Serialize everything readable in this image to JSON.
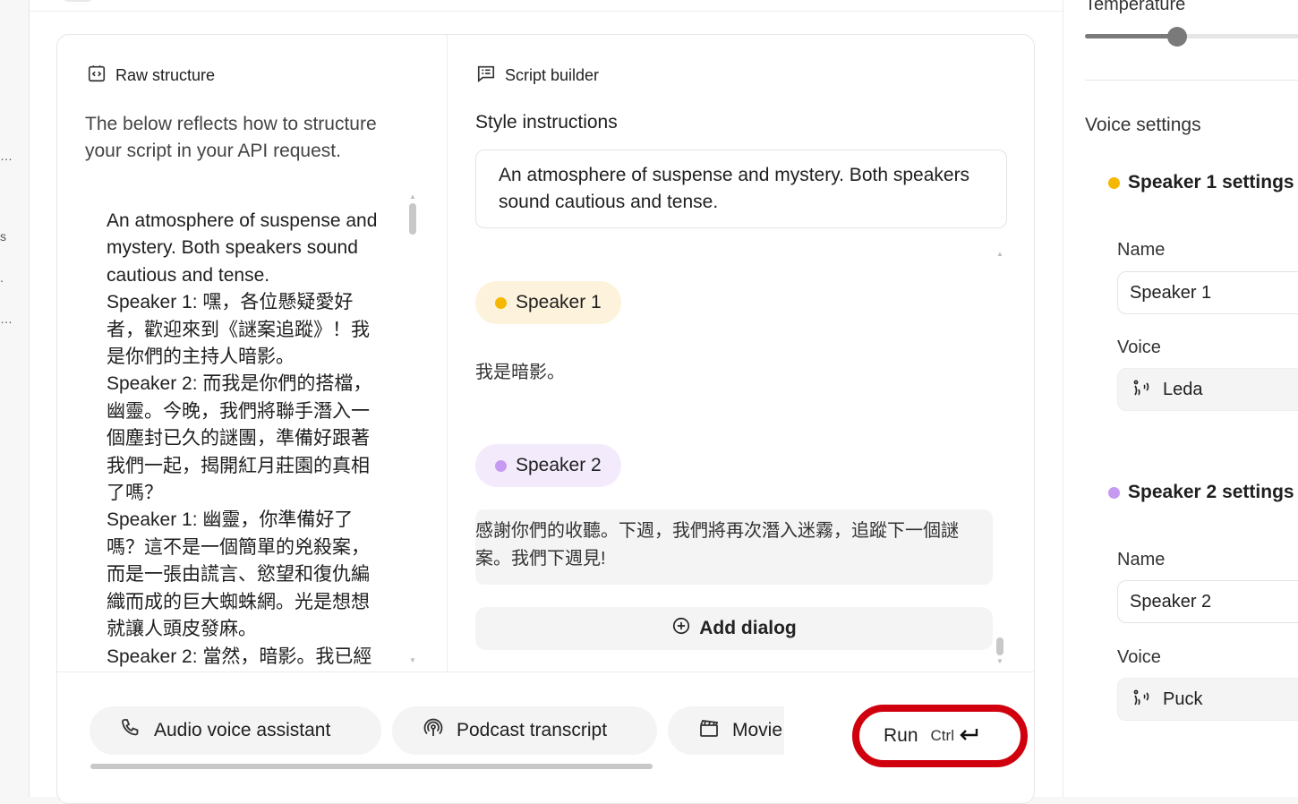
{
  "left_rail": {
    "fragments": [
      "…",
      "s",
      ".",
      "…"
    ]
  },
  "raw_structure": {
    "title": "Raw structure",
    "description": "The below reflects how to structure your script in your API request.",
    "lines": [
      "An atmosphere of suspense and mystery. Both speakers sound cautious and tense.",
      "Speaker 1: 嘿，各位懸疑愛好者，歡迎來到《謎案追蹤》！我是你們的主持人暗影。",
      "Speaker 2: 而我是你們的搭檔，幽靈。今晚，我們將聯手潛入一個塵封已久的謎團，準備好跟著我們一起，揭開紅月莊園的真相了嗎？",
      "Speaker 1: 幽靈，你準備好了嗎？這不是一個簡單的兇殺案，而是一張由謊言、慾望和復仇編織而成的巨大蜘蛛網。光是想想就讓人頭皮發麻。",
      "Speaker 2: 當然，暗影。我已經"
    ]
  },
  "script_builder": {
    "title": "Script builder",
    "style_label": "Style instructions",
    "style_text": "An atmosphere of suspense and mystery. Both speakers sound cautious and tense.",
    "dialogs": [
      {
        "speaker": "Speaker 1",
        "text": "我是暗影。",
        "color": "#f5b800"
      },
      {
        "speaker": "Speaker 2",
        "text": "感謝你們的收聽。下週，我們將再次潛入迷霧，追蹤下一個謎案。我們下週見!",
        "color": "#c69af0"
      }
    ],
    "add_dialog_label": "Add dialog"
  },
  "presets": [
    {
      "label": "Audio voice assistant",
      "icon": "phone-icon"
    },
    {
      "label": "Podcast transcript",
      "icon": "podcast-icon"
    },
    {
      "label": "Movie",
      "icon": "clapperboard-icon"
    }
  ],
  "run": {
    "label": "Run",
    "shortcut": "Ctrl",
    "accent": "#d0000e"
  },
  "settings": {
    "temperature_label": "Temperature",
    "temperature_fraction": 0.44,
    "voice_settings_title": "Voice settings",
    "speakers": [
      {
        "heading": "Speaker 1 settings",
        "name_label": "Name",
        "name_value": "Speaker 1",
        "voice_label": "Voice",
        "voice_value": "Leda",
        "color": "#f5b800"
      },
      {
        "heading": "Speaker 2 settings",
        "name_label": "Name",
        "name_value": "Speaker 2",
        "voice_label": "Voice",
        "voice_value": "Puck",
        "color": "#c69af0"
      }
    ]
  }
}
